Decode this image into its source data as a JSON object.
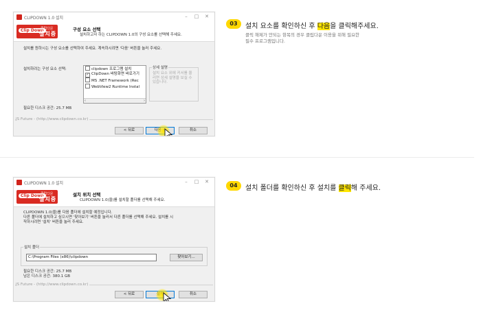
{
  "colors": {
    "accent_yellow": "#ffd800",
    "highlight": "#ffe500",
    "brand_red": "#d92b22",
    "focus_blue": "#0078d7"
  },
  "step3": {
    "number": "03",
    "text_before": "설치 요소를 확인하신 후 ",
    "text_highlight": "다음",
    "text_after": "을 클릭해주세요.",
    "note_line1": "클릭 해제가 안되는 항목의 경우 클립다운 이용을 위해 필요한",
    "note_line2": "필수 프로그램입니다."
  },
  "step4": {
    "number": "04",
    "text_before": "설치 폴더를 확인하신 후 설치를 ",
    "text_highlight": "클릭",
    "text_after": "해 주세요."
  },
  "window1": {
    "title": "CLIPDOWN 1.0 설치",
    "logo_badge": "Clip Down",
    "logo_small": "클립다운",
    "logo_big": "설치중",
    "header_title": "구성 요소 선택",
    "header_subtitle": "설치하고자 하는 CLIPDOWN 1.0의 구성 요소를 선택해 주세요.",
    "description": "설치를 원하시는 구성 요소를 선택하여 주세요. 계속하시려면 '다음' 버튼을 눌러 주세요.",
    "components_label": "설치하려는 구성 요소 선택:",
    "components": [
      {
        "checked": false,
        "label": "clipdown 프로그램 설치"
      },
      {
        "checked": true,
        "label": "ClipDown 바탕화면 바로가기"
      },
      {
        "checked": false,
        "label": "MS .NET Framework (Rec"
      },
      {
        "checked": false,
        "label": "WebView2 Runtime Instal"
      }
    ],
    "detail_group_label": "상세 설명",
    "detail_group_text": "설치 요소 위에 커서를 올리면 상세 설명을 보실 수 있습니다.",
    "disk_space": "필요한 디스크 공간: 25.7 MB",
    "url": "JS Future - (http://www.clipdown.co.kr)",
    "back_button": "< 뒤로",
    "next_button": "다음 >",
    "cancel_button": "취소"
  },
  "window2": {
    "title": "CLIPDOWN 1.0 설치",
    "logo_badge": "Clip Down",
    "logo_small": "클립다운",
    "logo_big": "설치중",
    "header_title": "설치 위치 선택",
    "header_subtitle": "CLIPDOWN 1.0(을)를 설치할 폴더를 선택해 주세요.",
    "description_line1": "CLIPDOWN 1.0(을)를 다음 폴더에 설치할 예정입니다.",
    "description_line2": "다른 폴더에 설치하고 싶으시면 '찾아보기' 버튼을 눌러서 다른 폴더를 선택해 주세요. 설치를 시",
    "description_line3": "작하시려면 '설치' 버튼을 눌러 주세요.",
    "folder_group_label": "설치 폴더",
    "folder_path": "C:\\Program Files (x86)\\clipdown",
    "browse_button": "찾아보기...",
    "disk_required": "필요한 디스크 공간: 25.7 MB",
    "disk_available": "남은 디스크 공간: 380.1 GB",
    "url": "JS Future - (http://www.clipdown.co.kr)",
    "back_button": "< 뒤로",
    "install_button": "설치",
    "cancel_button": "취소"
  }
}
